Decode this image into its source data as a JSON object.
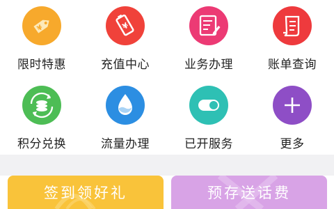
{
  "services": [
    {
      "label": "限时特惠",
      "icon": "price-tag-icon",
      "color": "#f7a92c"
    },
    {
      "label": "充值中心",
      "icon": "battery-charge-icon",
      "color": "#f0423a"
    },
    {
      "label": "业务办理",
      "icon": "document-edit-icon",
      "color": "#ec3a74"
    },
    {
      "label": "账单查询",
      "icon": "receipt-icon",
      "color": "#ee3a3d"
    },
    {
      "label": "积分兑换",
      "icon": "coin-exchange-icon",
      "color": "#4dbd55"
    },
    {
      "label": "流量办理",
      "icon": "water-drop-icon",
      "color": "#2c8ee2"
    },
    {
      "label": "已开服务",
      "icon": "toggle-switch-icon",
      "color": "#2ec0b4"
    },
    {
      "label": "更多",
      "icon": "plus-icon",
      "color": "#8e4ec6"
    }
  ],
  "promo": {
    "checkin_label": "签到领好礼",
    "prepay_label": "预存送话费"
  }
}
